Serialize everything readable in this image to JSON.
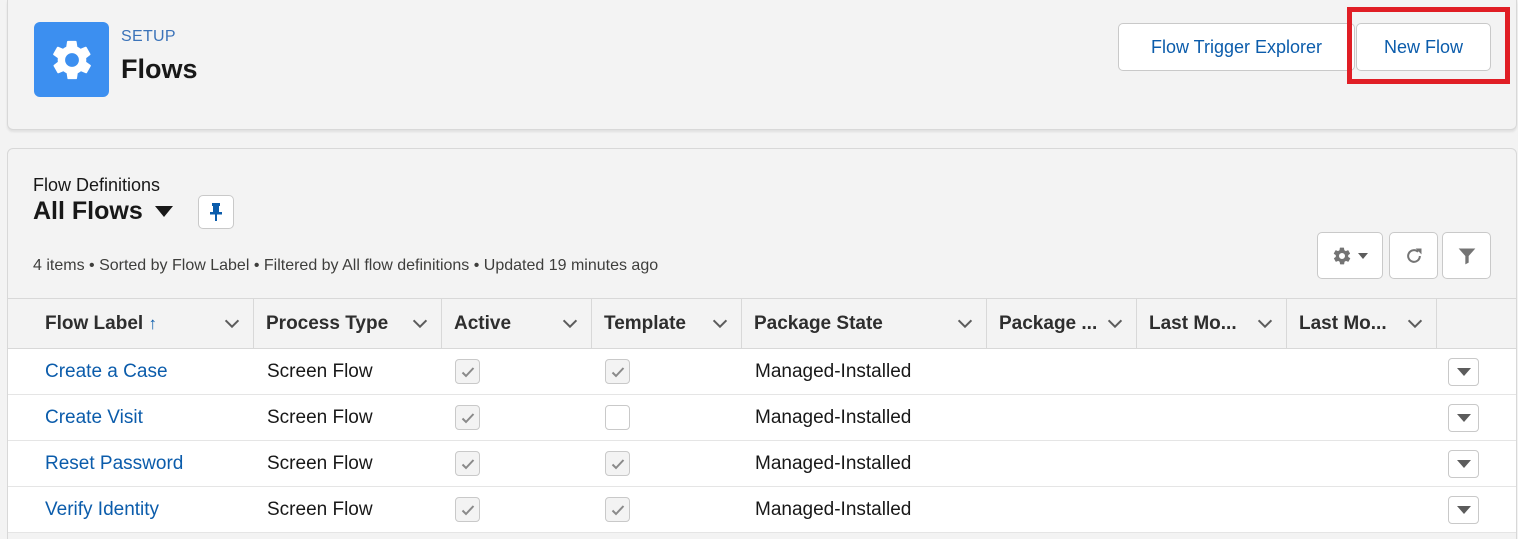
{
  "header": {
    "eyebrow": "SETUP",
    "title": "Flows",
    "icon": "gear-icon",
    "buttons": {
      "flow_trigger_explorer": "Flow Trigger Explorer",
      "new_flow": "New Flow"
    }
  },
  "list": {
    "eyebrow": "Flow Definitions",
    "title": "All Flows",
    "meta": "4 items • Sorted by Flow Label • Filtered by All flow definitions • Updated 19 minutes ago",
    "sort_indicator": "↑",
    "columns": [
      "Flow Label",
      "Process Type",
      "Active",
      "Template",
      "Package State",
      "Package ...",
      "Last Mo...",
      "Last Mo..."
    ],
    "rows": [
      {
        "label": "Create a Case",
        "process_type": "Screen Flow",
        "active": true,
        "template": true,
        "package_state": "Managed-Installed"
      },
      {
        "label": "Create Visit",
        "process_type": "Screen Flow",
        "active": true,
        "template": false,
        "package_state": "Managed-Installed"
      },
      {
        "label": "Reset Password",
        "process_type": "Screen Flow",
        "active": true,
        "template": true,
        "package_state": "Managed-Installed"
      },
      {
        "label": "Verify Identity",
        "process_type": "Screen Flow",
        "active": true,
        "template": true,
        "package_state": "Managed-Installed"
      }
    ]
  },
  "colors": {
    "brand_blue": "#0b5cab",
    "icon_bg": "#3c8ff0",
    "highlight": "#e01e25"
  }
}
